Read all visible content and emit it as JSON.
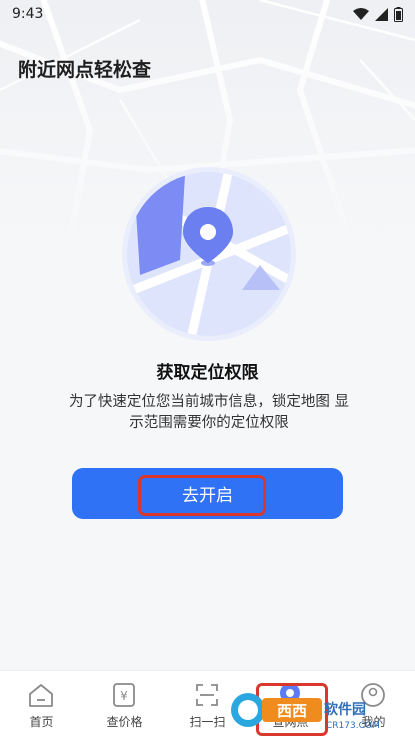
{
  "status_bar": {
    "time": "9:43",
    "icons": [
      "wifi-icon",
      "signal-icon",
      "battery-icon"
    ]
  },
  "page": {
    "title": "附近网点轻松查"
  },
  "permission": {
    "title": "获取定位权限",
    "description": "为了快速定位您当前城市信息，锁定地图 显示范围需要你的定位权限",
    "button_label": "去开启"
  },
  "tab_bar": {
    "items": [
      {
        "label": "首页",
        "icon": "home-icon"
      },
      {
        "label": "查价格",
        "icon": "price-icon"
      },
      {
        "label": "扫一扫",
        "icon": "scan-icon"
      },
      {
        "label": "查网点",
        "icon": "location-icon"
      },
      {
        "label": "我的",
        "icon": "user-icon"
      }
    ]
  },
  "watermark": {
    "text": "西西软件园",
    "domain": "CR173.COM"
  },
  "colors": {
    "primary": "#2f72f5",
    "highlight": "#d9372b",
    "illustration_accent": "#7c8cf4"
  }
}
